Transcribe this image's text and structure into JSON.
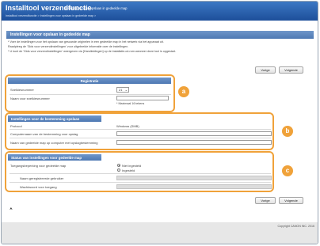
{
  "header": {
    "title": "Installtool verzendfunctie",
    "subtitle": "Instellingen voor opslaan in gedeelde map",
    "breadcrumb": "Installtool verzendfunctie >  Instellingen voor opslaan in gedeelde map  >"
  },
  "page": {
    "banner": "Instellingen voor opslaan in gedeelde map",
    "desc_line1": "* Voer de instellingen voor het opslaan van gescande originelen in een gedeelde map in het netwerk via het apparaat uit.",
    "desc_line2": "Raadpleeg de 'Gids voor verzendinstellingen' voor uitgebreide informatie over de instellingen.",
    "desc_line3": "* U kunt de 'Gids voor verzendinstellingen' weergeven via [Handleidingen] op de installatie-cd-rom wanneer deze tool is opgestart."
  },
  "buttons": {
    "back": "Vorige",
    "next": "Volgende"
  },
  "callouts": {
    "a": "a",
    "b": "b",
    "c": "c"
  },
  "registration": {
    "title": "Registratie",
    "speed_dial_label": "Snelkiesnummer",
    "speed_dial_value": "21",
    "speed_dial_name_label": "Naam voor snelkiesnummer",
    "max_chars": "* Maximaal 16 tekens"
  },
  "destination": {
    "title": "Instellingen voor de bestemming opslaan",
    "protocol_label": "Protocol",
    "protocol_value": "Windows (SMB)",
    "computer_label": "Computernaam van de bestemming voor opslag",
    "folder_label": "Naam van gedeelde map op computer met opslagbestemming"
  },
  "status": {
    "title": "Status van instellingen voor gedeelde map",
    "access_label": "Toegangsbeperking voor gedeelde map",
    "option_not_set": "Niet ingesteld",
    "option_set": "Ingesteld",
    "username_label": "Naam geregistreerde gebruiker",
    "password_label": "Wachtwoord voor toegang"
  },
  "footer": {
    "top_mark": "⮝",
    "copyright": "Copyright CANON INC. 2016"
  },
  "colors": {
    "accent": "#f0a23a",
    "header_blue": "#1d4f9a",
    "section_blue": "#4e78b3"
  }
}
